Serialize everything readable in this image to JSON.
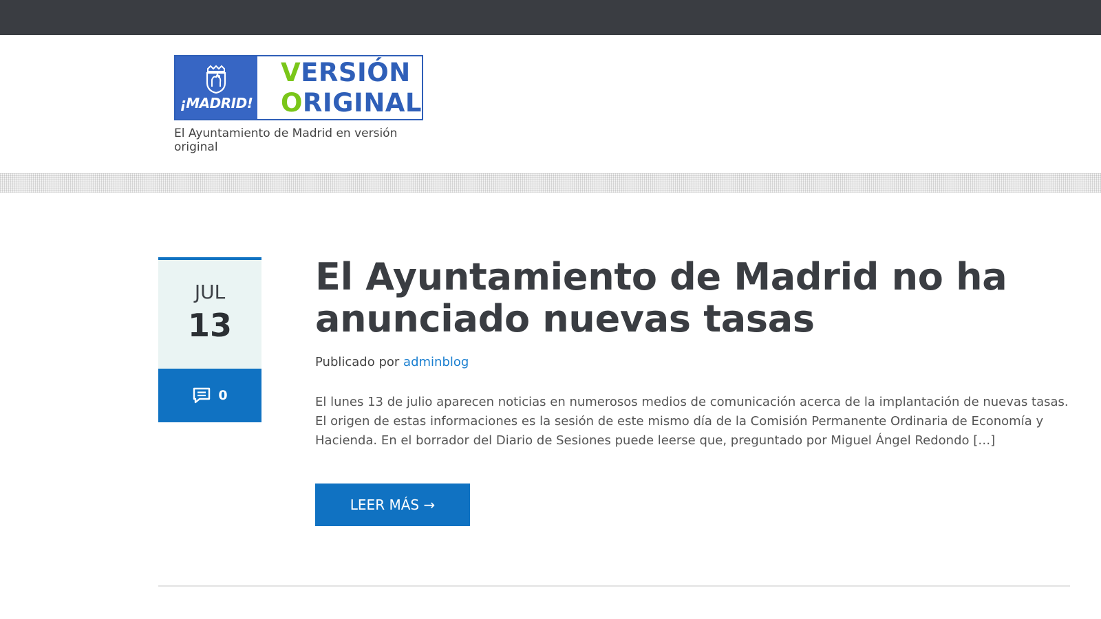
{
  "header": {
    "logo": {
      "brand": "¡MADRID!",
      "line1_initial": "V",
      "line1_rest": "ERSIÓN",
      "line2_initial": "O",
      "line2_rest": "RIGINAL",
      "colors": {
        "blue": "#3766c4",
        "green": "#7ac619"
      }
    },
    "tagline": "El Ayuntamiento de Madrid en versión original"
  },
  "post": {
    "date": {
      "month": "JUL",
      "day": "13"
    },
    "comments": {
      "icon": "comment-icon",
      "count": "0"
    },
    "title": "El Ayuntamiento de Madrid no ha anunciado nuevas tasas",
    "byline_prefix": "Publicado por",
    "author": "adminblog",
    "excerpt": "El lunes 13 de julio aparecen noticias en numerosos medios de comunicación acerca de la implantación de nuevas tasas. El origen de estas informaciones es la sesión de este mismo día de la Comisión Permanente Ordinaria de Economía y Hacienda. En el borrador del Diario de Sesiones puede leerse que, preguntado por Miguel Ángel Redondo […]",
    "read_more": "LEER MÁS →"
  },
  "colors": {
    "accent": "#1072c2",
    "topbar": "#3a3d42",
    "link": "#1a7fd0"
  }
}
